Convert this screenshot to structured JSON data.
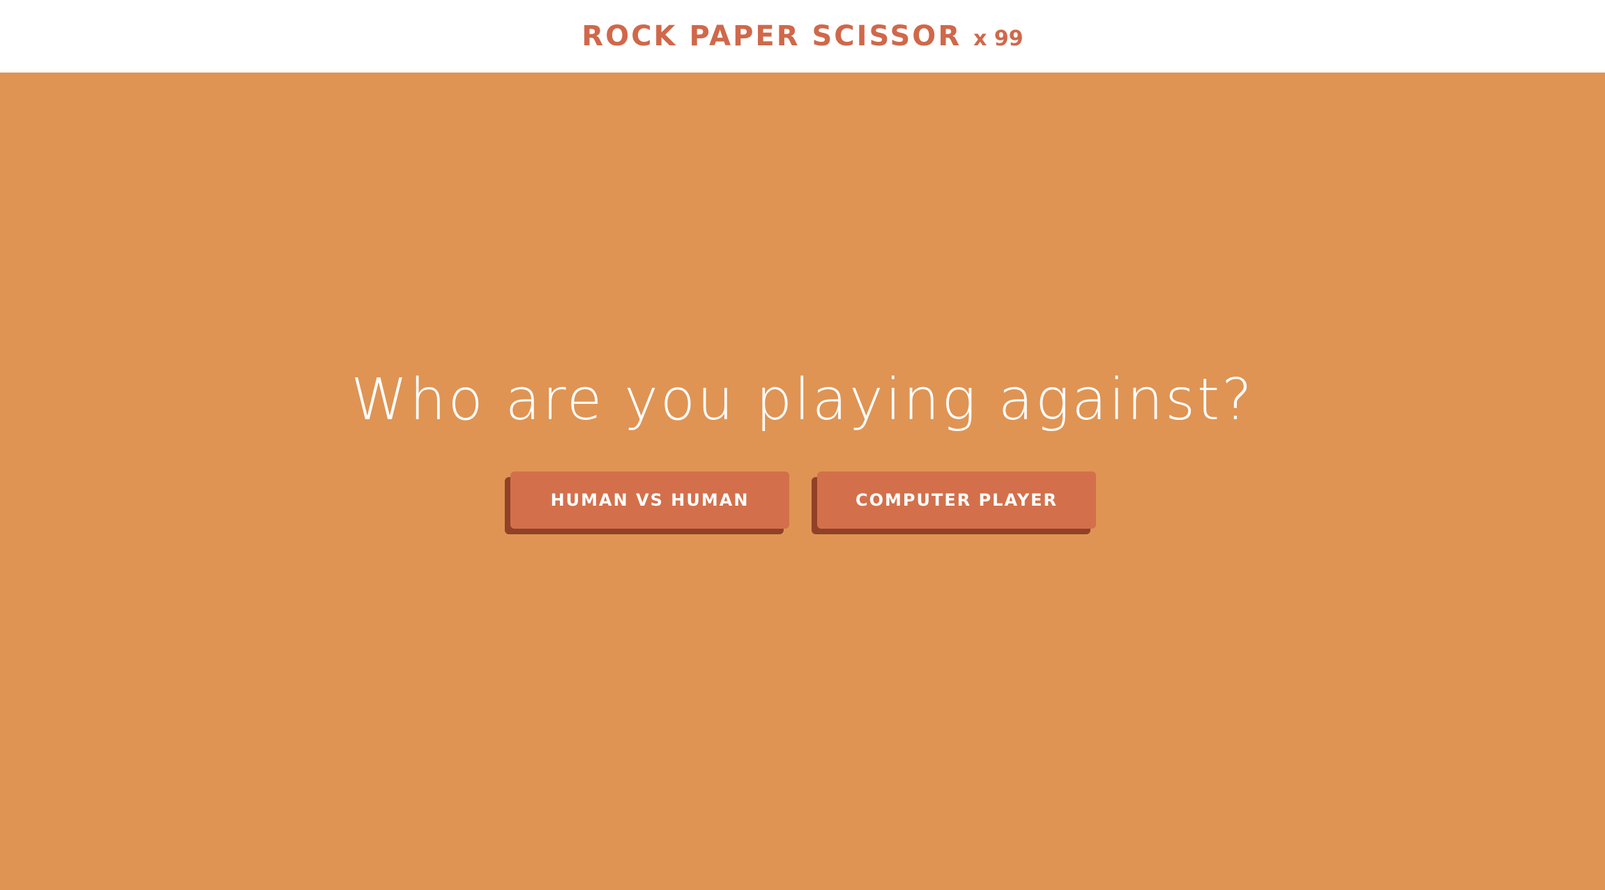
{
  "header": {
    "title": "ROCK PAPER SCISSOR",
    "title_suffix": "x 99"
  },
  "main": {
    "question": "Who are you playing against?",
    "options": [
      {
        "label": "HUMAN VS HUMAN"
      },
      {
        "label": "COMPUTER PLAYER"
      }
    ]
  },
  "colors": {
    "background": "#df9454",
    "header_background": "#ffffff",
    "accent": "#d3704b",
    "button_shadow": "#904128",
    "title_text": "#d0684a",
    "question_text": "#ffffff"
  }
}
